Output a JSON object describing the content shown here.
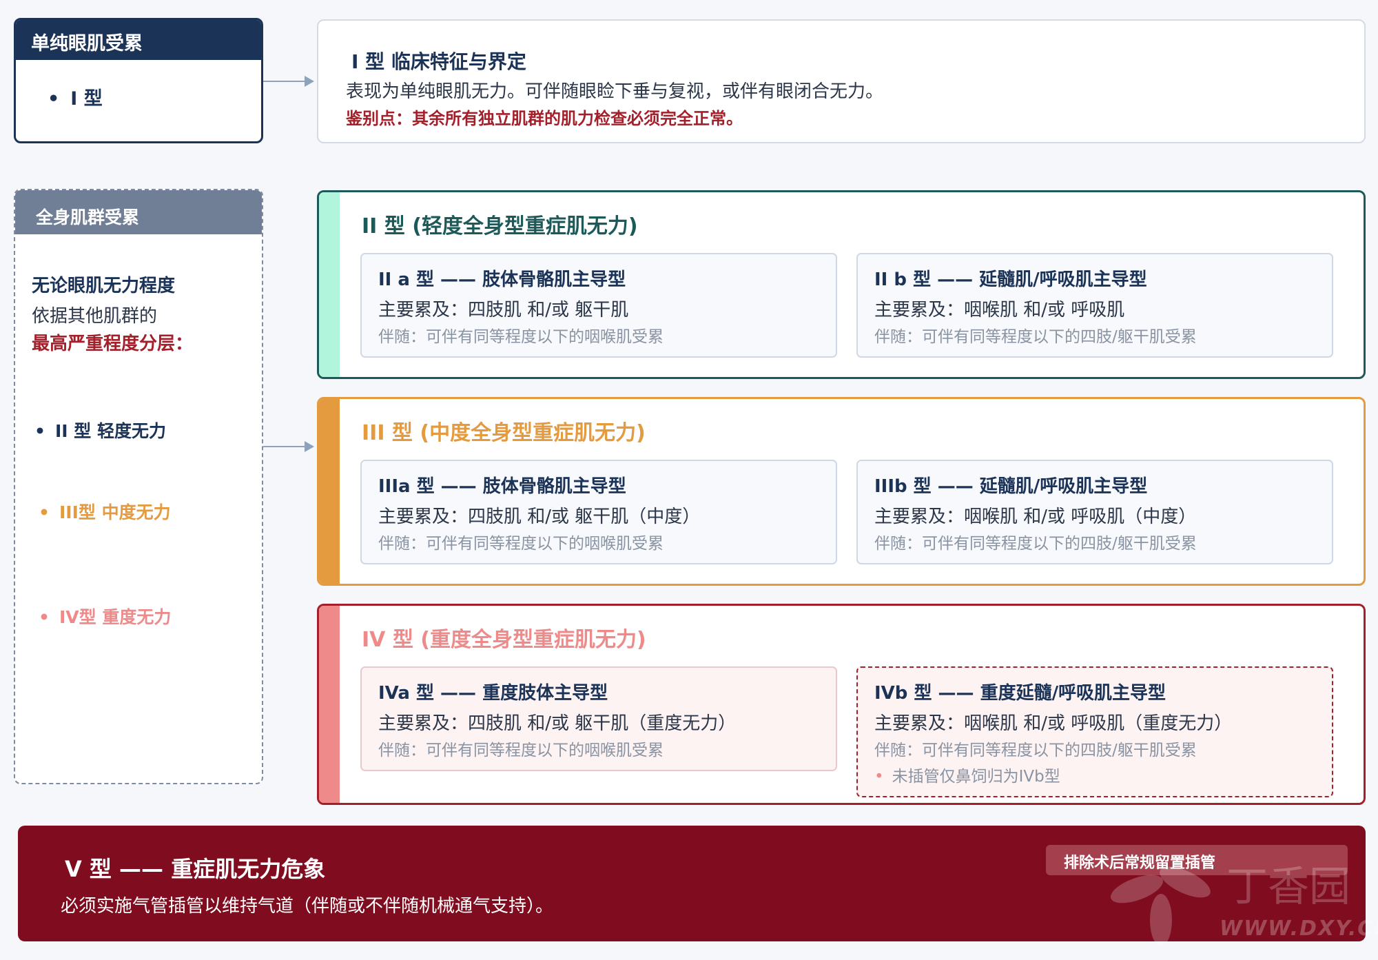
{
  "left": {
    "ocular": {
      "header": "单纯眼肌受累",
      "item": "I 型"
    },
    "general": {
      "header": "全身肌群受累",
      "line1": "无论眼肌无力程度",
      "line2": "依据其他肌群的",
      "line3": "最高严重程度分层：",
      "items": [
        {
          "label": "II 型 轻度无力",
          "color": "#1c3358"
        },
        {
          "label": "III型 中度无力",
          "color": "#e49a3e"
        },
        {
          "label": "IV型 重度无力",
          "color": "#ee8a8a"
        }
      ]
    }
  },
  "type1": {
    "title": "I 型 临床特征与界定",
    "desc": "表现为单纯眼肌无力。可伴随眼睑下垂与复视，或伴有眼闭合无力。",
    "note": "鉴别点：其余所有独立肌群的肌力检查必须完全正常。"
  },
  "type2": {
    "title": "II 型 (轻度全身型重症肌无力)",
    "color": "#1c5a5a",
    "bar": "#b0f5dc",
    "a": {
      "title": "II a 型 —— 肢体骨骼肌主导型",
      "main": "主要累及：四肢肌 和/或 躯干肌",
      "acc": "伴随：可伴有同等程度以下的咽喉肌受累"
    },
    "b": {
      "title": "II b 型 —— 延髓肌/呼吸肌主导型",
      "main": "主要累及：咽喉肌 和/或 呼吸肌",
      "acc": "伴随：可伴有同等程度以下的四肢/躯干肌受累"
    }
  },
  "type3": {
    "title": "III 型 (中度全身型重症肌无力)",
    "color": "#e49a3e",
    "a": {
      "title": "IIIa 型 —— 肢体骨骼肌主导型",
      "main": "主要累及：四肢肌 和/或 躯干肌（中度）",
      "acc": "伴随：可伴有同等程度以下的咽喉肌受累"
    },
    "b": {
      "title": "IIIb 型 —— 延髓肌/呼吸肌主导型",
      "main": "主要累及：咽喉肌 和/或 呼吸肌（中度）",
      "acc": "伴随：可伴有同等程度以下的四肢/躯干肌受累"
    }
  },
  "type4": {
    "title": "IV 型 (重度全身型重症肌无力)",
    "color": "#ee8a8a",
    "border": "#a3202b",
    "a": {
      "title": "IVa 型 —— 重度肢体主导型",
      "main": "主要累及：四肢肌 和/或 躯干肌（重度无力）",
      "acc": "伴随：可伴有同等程度以下的咽喉肌受累"
    },
    "b": {
      "title": "IVb 型 —— 重度延髓/呼吸肌主导型",
      "main": "主要累及：咽喉肌 和/或 呼吸肌（重度无力）",
      "acc": "伴随：可伴有同等程度以下的四肢/躯干肌受累",
      "extra": "未插管仅鼻饲归为IVb型"
    }
  },
  "type5": {
    "title": "V 型 —— 重症肌无力危象",
    "desc": "必须实施气管插管以维持气道（伴随或不伴随机械通气支持）。",
    "badge": "排除术后常规留置插管"
  },
  "watermark": {
    "cn": "丁香园",
    "en": "WWW.DXY.CN"
  }
}
